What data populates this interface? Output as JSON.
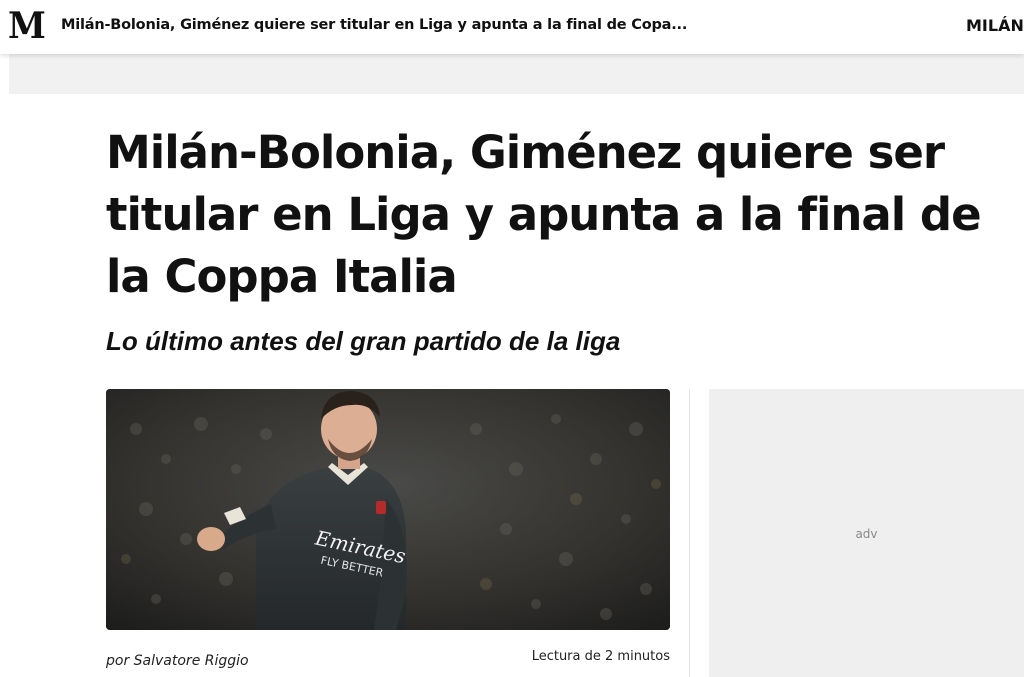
{
  "header": {
    "logo_text": "M",
    "title": "Milán-Bolonia, Giménez quiere ser titular en Liga y apunta a la final de Copa...",
    "section": "MILÁN"
  },
  "article": {
    "headline": "Milán-Bolonia, Giménez quiere ser titular en Liga y apunta a la final de la Coppa Italia",
    "subtitle": "Lo último antes del gran partido de la liga",
    "photo": {
      "shirt_sponsor_line1": "Emirates",
      "shirt_sponsor_line2": "FLY BETTER"
    },
    "byline": "por Salvatore Riggio",
    "reading_time": "Lectura de 2 minutos"
  },
  "ad": {
    "label": "adv"
  },
  "colors": {
    "text": "#111111",
    "ad_background": "#efefef",
    "ad_strip": "#f1f1f1",
    "jersey": "#2f3436"
  }
}
